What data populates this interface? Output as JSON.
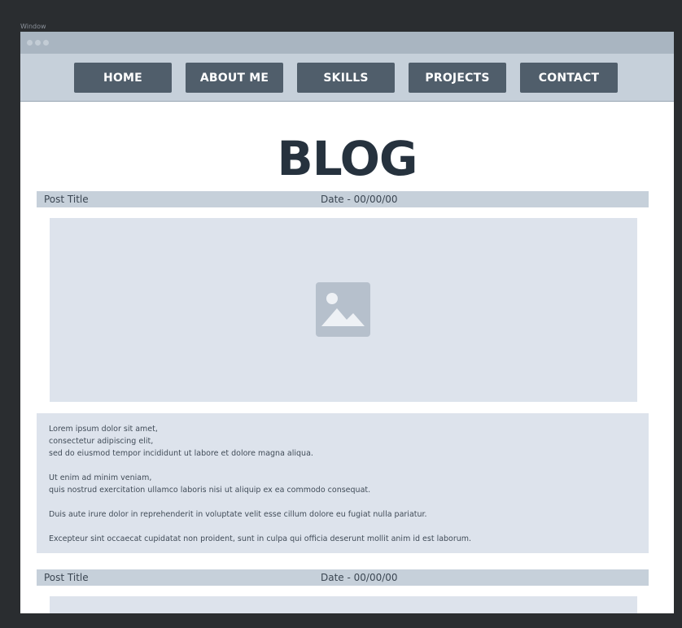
{
  "canvas": {
    "label": "Window"
  },
  "nav": {
    "items": [
      {
        "label": "HOME"
      },
      {
        "label": "ABOUT ME"
      },
      {
        "label": "SKILLS"
      },
      {
        "label": "PROJECTS"
      },
      {
        "label": "CONTACT"
      }
    ]
  },
  "page": {
    "title": "BLOG"
  },
  "posts": [
    {
      "title": "Post Title",
      "date": "Date - 00/00/00",
      "image_icon": "image-placeholder-icon",
      "body": [
        [
          "Lorem ipsum dolor sit amet,",
          "consectetur adipiscing elit,",
          "sed do eiusmod tempor incididunt ut labore et dolore magna aliqua."
        ],
        [
          "Ut enim ad minim veniam,",
          "quis nostrud exercitation ullamco laboris nisi ut aliquip ex ea commodo consequat."
        ],
        [
          "Duis aute irure dolor in reprehenderit in voluptate velit esse cillum dolore eu fugiat nulla pariatur."
        ],
        [
          "Excepteur sint occaecat cupidatat non proident, sunt in culpa qui officia deserunt mollit anim id est laborum."
        ]
      ]
    },
    {
      "title": "Post Title",
      "date": "Date - 00/00/00"
    }
  ],
  "colors": {
    "titlebar": "#a9b5c1",
    "navbar": "#c6d0da",
    "nav_button": "#505e6b",
    "title_text": "#26323e",
    "placeholder": "#dde3ec"
  }
}
